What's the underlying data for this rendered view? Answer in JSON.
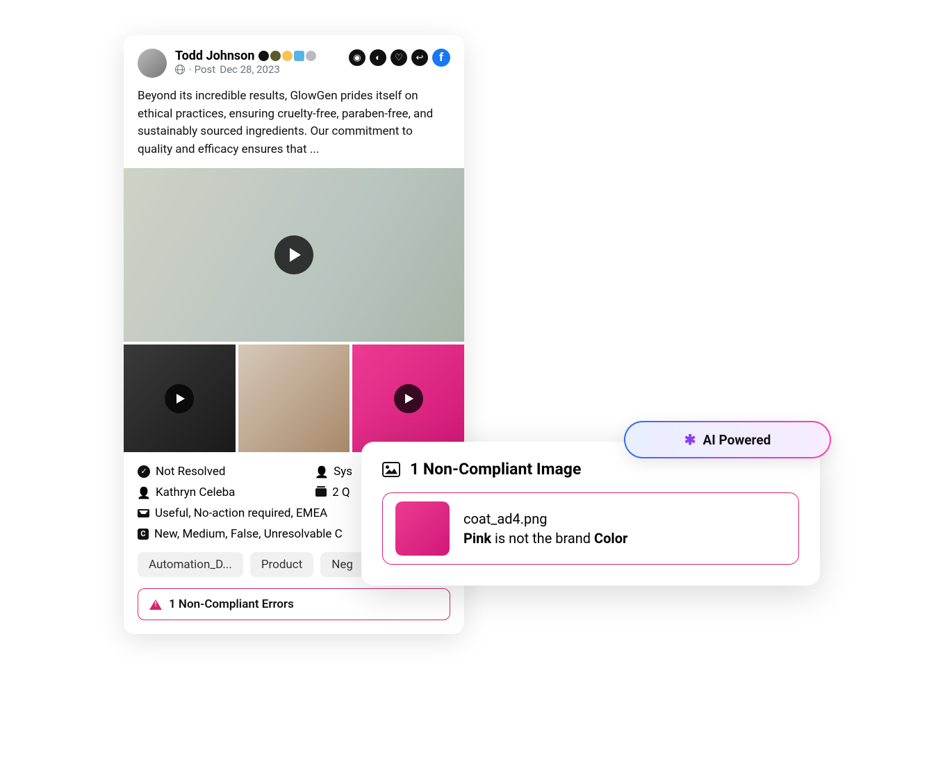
{
  "post": {
    "author": "Todd Johnson",
    "meta_prefix": "· Post",
    "date": "Dec 28, 2023",
    "body": "Beyond its incredible results, GlowGen prides itself on ethical practices, ensuring cruelty-free, paraben-free, and sustainably sourced ingredients. Our commitment to quality and efficacy ensures that ..."
  },
  "status": {
    "resolution": "Not Resolved",
    "system": "Sys",
    "assignee": "Kathryn Celeba",
    "q_count": "2 Q",
    "tags_line": "Useful, No-action required, EMEA",
    "c_line": "New, Medium, False, Unresolvable C"
  },
  "chips": [
    "Automation_D...",
    "Product",
    "Neg"
  ],
  "error_banner": "1 Non-Compliant Errors",
  "detail": {
    "title": "1 Non-Compliant Image",
    "filename": "coat_ad4.png",
    "reason_word1": "Pink",
    "reason_mid": " is not the brand ",
    "reason_word2": "Color"
  },
  "ai_label": "AI Powered"
}
